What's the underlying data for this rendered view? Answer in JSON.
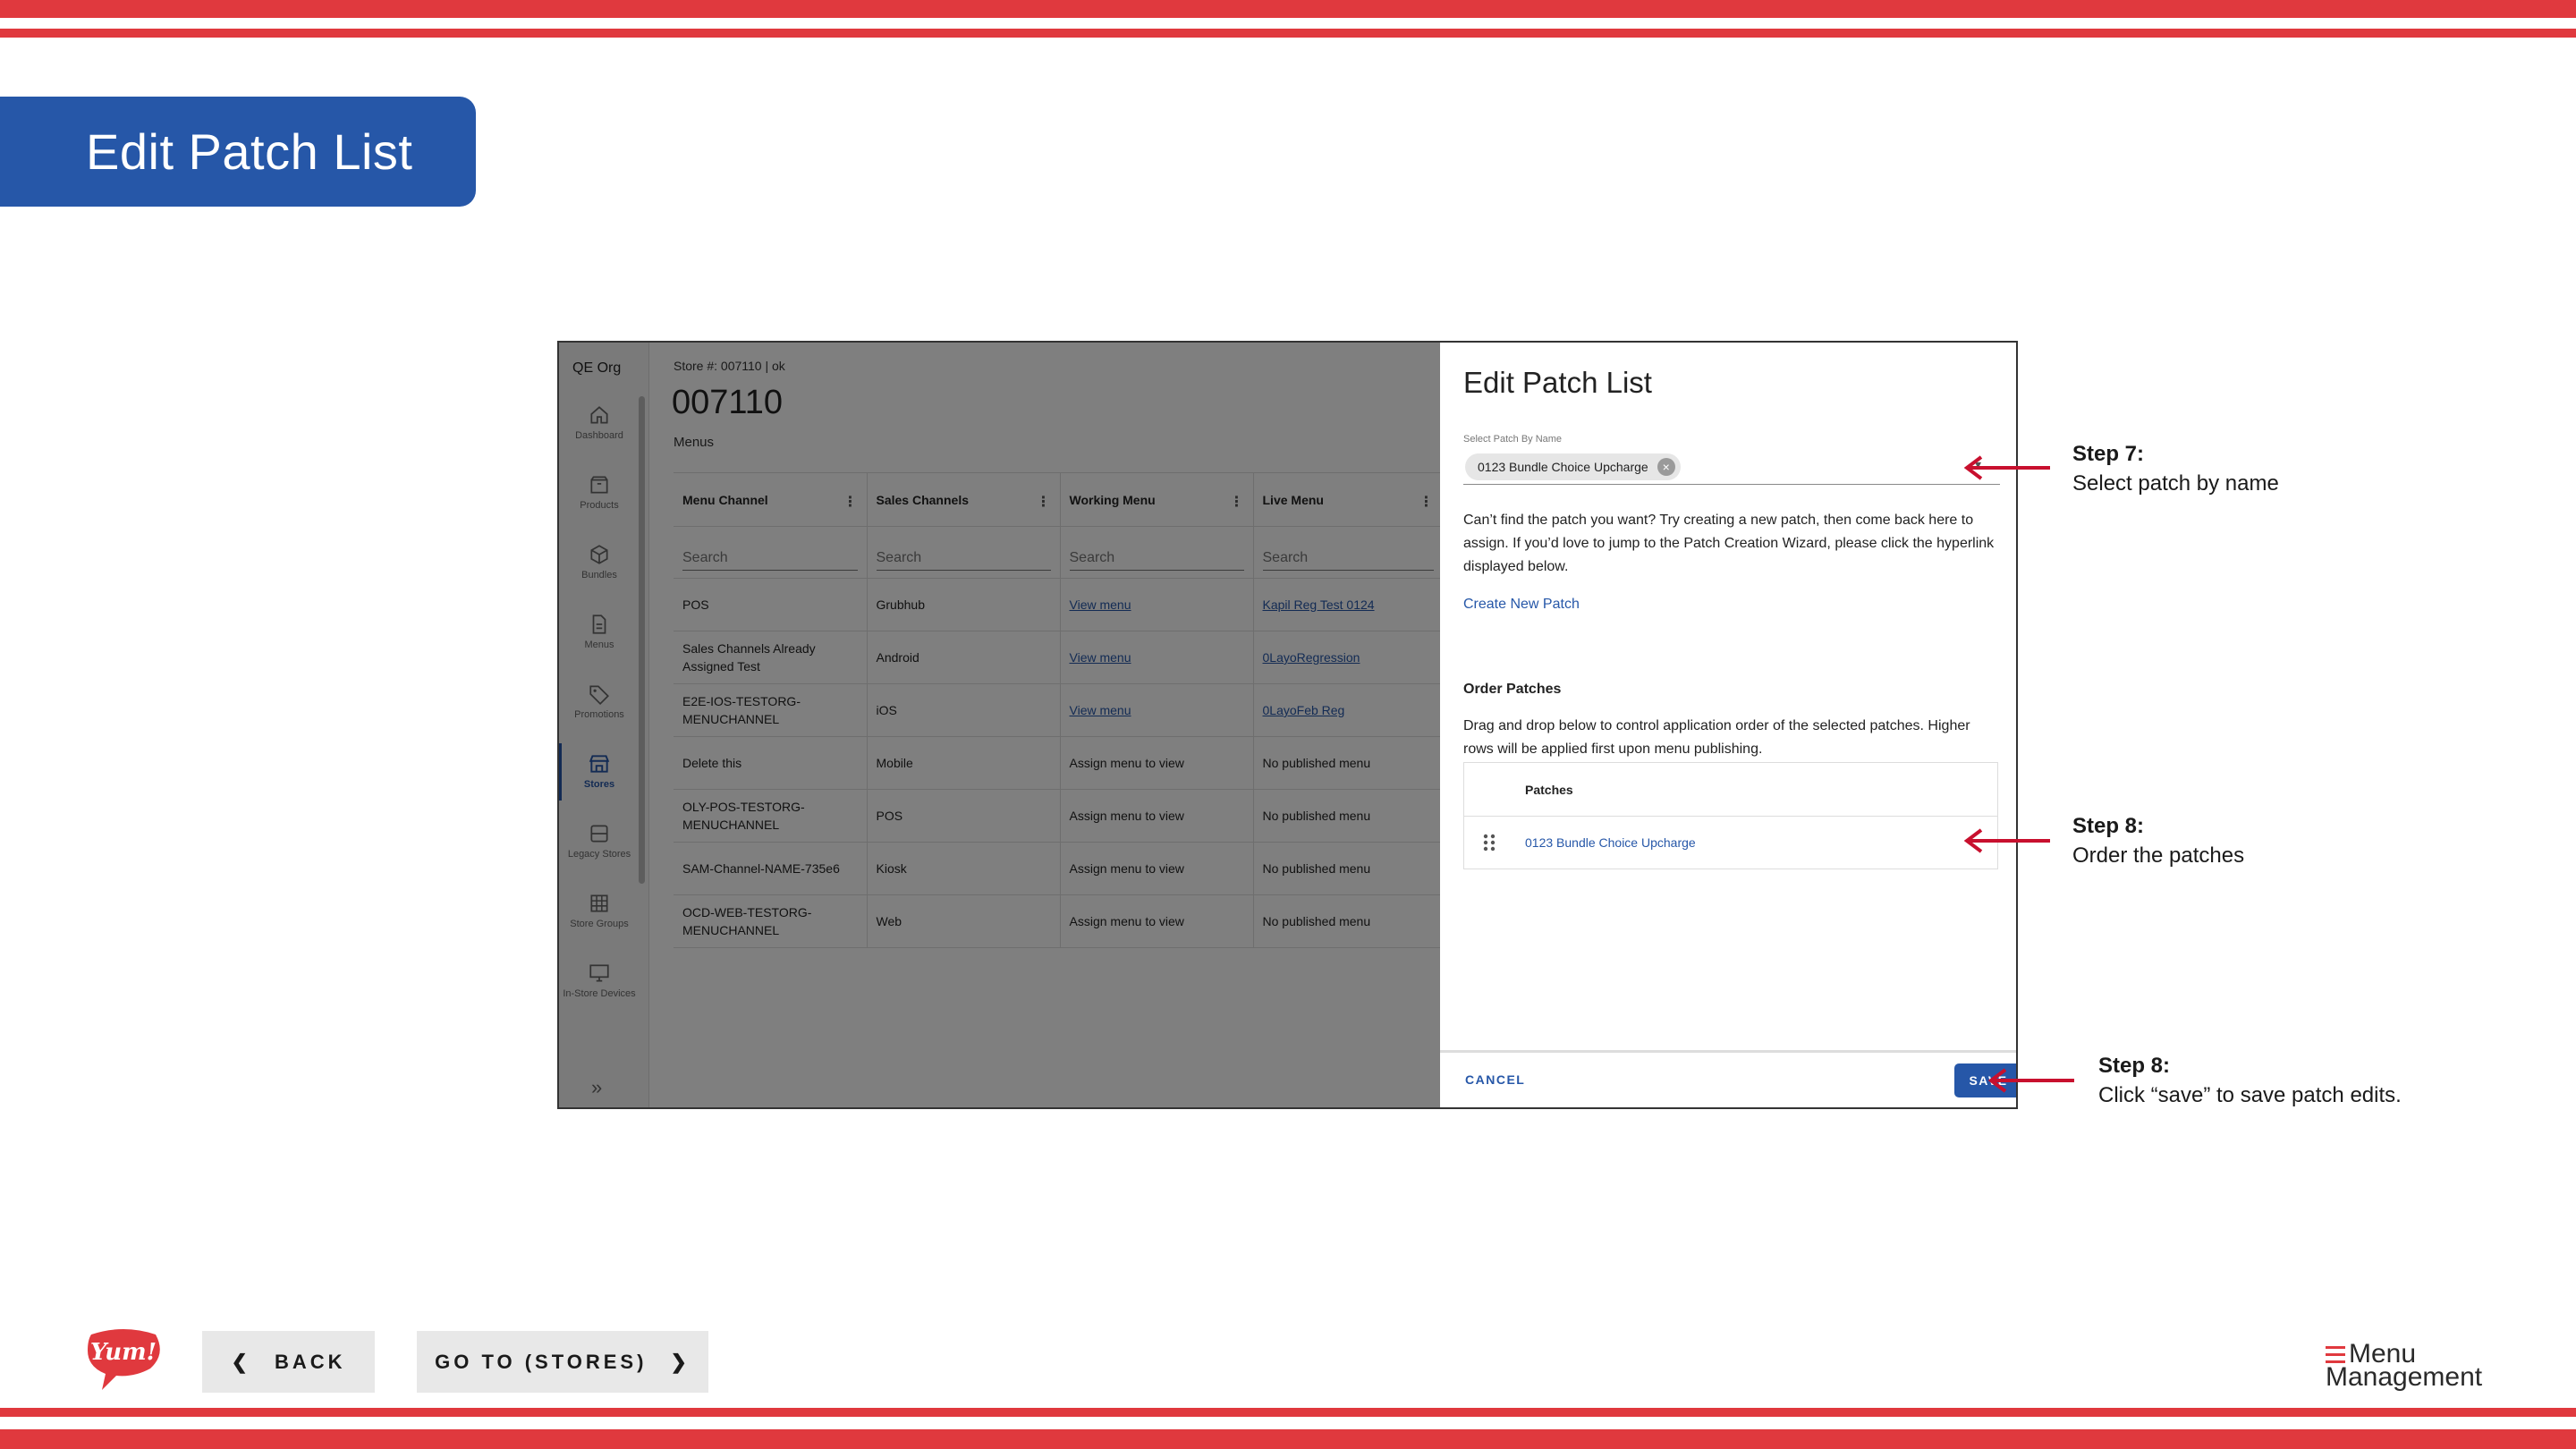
{
  "slide": {
    "title": "Edit Patch List"
  },
  "app": {
    "org": "QE Org",
    "nav": [
      {
        "label": "Dashboard",
        "icon": "home-icon"
      },
      {
        "label": "Products",
        "icon": "box-icon"
      },
      {
        "label": "Bundles",
        "icon": "cube-icon"
      },
      {
        "label": "Menus",
        "icon": "document-icon"
      },
      {
        "label": "Promotions",
        "icon": "tag-icon"
      },
      {
        "label": "Stores",
        "icon": "store-icon",
        "active": true
      },
      {
        "label": "Legacy Stores",
        "icon": "database-icon"
      },
      {
        "label": "Store Groups",
        "icon": "grid-icon"
      },
      {
        "label": "In-Store Devices",
        "icon": "monitor-icon"
      }
    ],
    "breadcrumb": "Store #: 007110 | ok",
    "store_number": "007110",
    "section": "Menus",
    "table": {
      "columns": [
        "Menu Channel",
        "Sales Channels",
        "Working Menu",
        "Live Menu"
      ],
      "search_placeholder": "Search",
      "rows": [
        {
          "channel": "POS",
          "sales": "Grubhub",
          "working": "View menu",
          "working_link": true,
          "live": "Kapil Reg Test 0124",
          "live_link": true
        },
        {
          "channel": "Sales Channels Already Assigned Test",
          "sales": "Android",
          "working": "View menu",
          "working_link": true,
          "live": "0LayoRegression",
          "live_link": true
        },
        {
          "channel": "E2E-IOS-TESTORG-MENUCHANNEL",
          "sales": "iOS",
          "working": "View menu",
          "working_link": true,
          "live": "0LayoFeb Reg",
          "live_link": true
        },
        {
          "channel": "Delete this",
          "sales": "Mobile",
          "working": "Assign menu to view",
          "working_link": false,
          "live": "No published menu",
          "live_link": false
        },
        {
          "channel": "OLY-POS-TESTORG-MENUCHANNEL",
          "sales": "POS",
          "working": "Assign menu to view",
          "working_link": false,
          "live": "No published menu",
          "live_link": false
        },
        {
          "channel": "SAM-Channel-NAME-735e6",
          "sales": "Kiosk",
          "working": "Assign menu to view",
          "working_link": false,
          "live": "No published menu",
          "live_link": false
        },
        {
          "channel": "OCD-WEB-TESTORG-MENUCHANNEL",
          "sales": "Web",
          "working": "Assign menu to view",
          "working_link": false,
          "live": "No published menu",
          "live_link": false
        }
      ]
    }
  },
  "drawer": {
    "title": "Edit Patch List",
    "select_label": "Select Patch By Name",
    "selected_chip": "0123 Bundle Choice Upcharge",
    "help_text": "Can’t find the patch you want? Try creating a new patch, then come back here to assign. If you’d love to jump to the Patch Creation Wizard, please click the hyperlink displayed below.",
    "create_link": "Create New Patch",
    "order_heading": "Order Patches",
    "order_help": "Drag and drop below to control application order of the selected patches. Higher rows will be applied first upon menu publishing.",
    "patches_header": "Patches",
    "patches": [
      "0123 Bundle Choice Upcharge"
    ],
    "cancel": "CANCEL",
    "save": "SAVE"
  },
  "annotations": [
    {
      "step": "Step 7:",
      "text": "Select patch by name"
    },
    {
      "step": "Step 8:",
      "text": "Order the patches"
    },
    {
      "step": "Step 8:",
      "text": "Click “save” to save patch edits."
    }
  ],
  "footer": {
    "back": "BACK",
    "goto": "GO TO (STORES)",
    "logo_yum": "Yum!",
    "logo_mm_1": "Menu",
    "logo_mm_2": "Management"
  },
  "colors": {
    "brand_red": "#e0393e",
    "brand_blue": "#2657a8",
    "arrow": "#c8102e"
  }
}
